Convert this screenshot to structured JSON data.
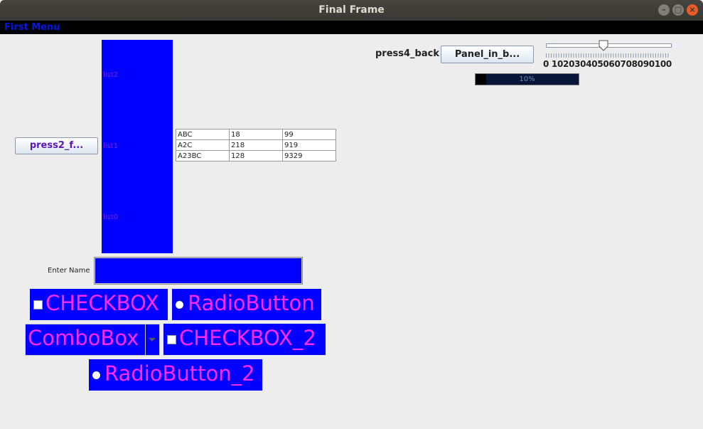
{
  "window": {
    "title": "Final Frame"
  },
  "menu": {
    "items": [
      "First Menu"
    ]
  },
  "buttons": {
    "press2": "press2_f...",
    "panel_in_b": "Panel_in_b..."
  },
  "press4_label": "press4_back",
  "list": {
    "items": [
      "list2",
      "list1",
      "list0"
    ]
  },
  "table": {
    "rows": [
      [
        "ABC",
        "18",
        "99"
      ],
      [
        "A2C",
        "218",
        "919"
      ],
      [
        "A23BC",
        "128",
        "9329"
      ]
    ]
  },
  "name_label": "Enter Name",
  "name_value": "",
  "checkbox1": "CHECKBOX",
  "radio1": "RadioButton",
  "combobox": "ComboBox",
  "checkbox2": "CHECKBOX_2",
  "radio2": "RadioButton_2",
  "slider": {
    "value": 50,
    "min": 0,
    "max": 100,
    "tick_labels": "0 102030405060708090100"
  },
  "progress": {
    "value": 0.1,
    "text": "10%"
  },
  "colors": {
    "control_bg": "#0000ff",
    "control_text": "#ff29ff",
    "list_text": "#7a26c9"
  }
}
